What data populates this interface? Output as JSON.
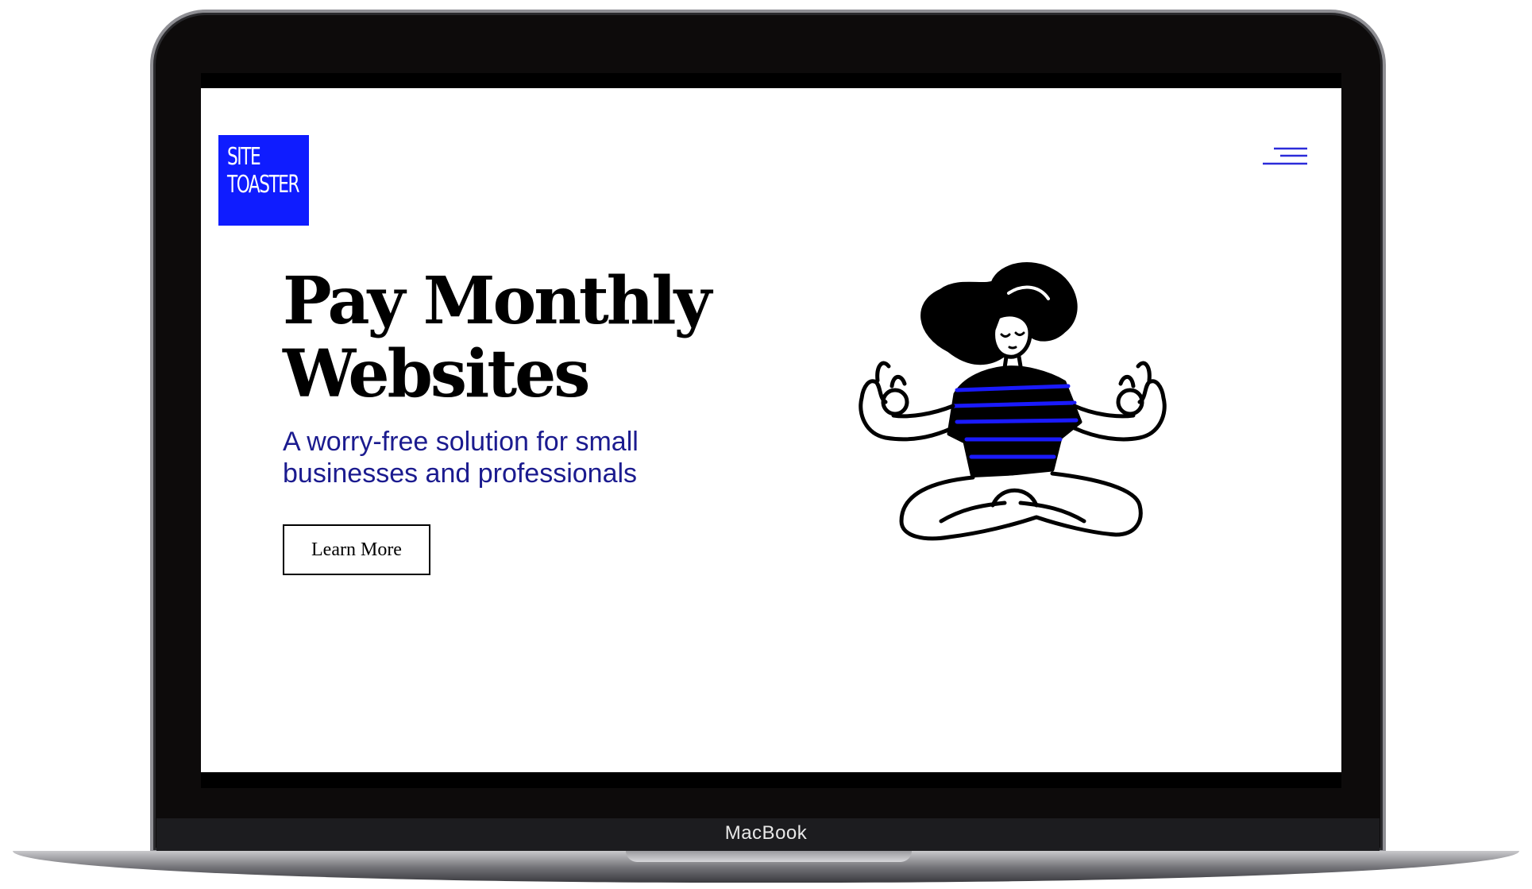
{
  "device": {
    "label": "MacBook"
  },
  "site": {
    "logo": {
      "line1": "SITE",
      "line2": "TOASTER"
    },
    "hero": {
      "title_line1": "Pay Monthly",
      "title_line2": "Websites",
      "subtitle": "A worry-free solution for small businesses and professionals",
      "cta_label": "Learn More"
    }
  },
  "colors": {
    "brand_blue": "#0f1cff",
    "subtitle_navy": "#1b1b8f",
    "menu_blue": "#2b2bd9"
  },
  "icons": {
    "menu": "hamburger-menu-icon",
    "illustration": "meditating-woman-illustration"
  }
}
